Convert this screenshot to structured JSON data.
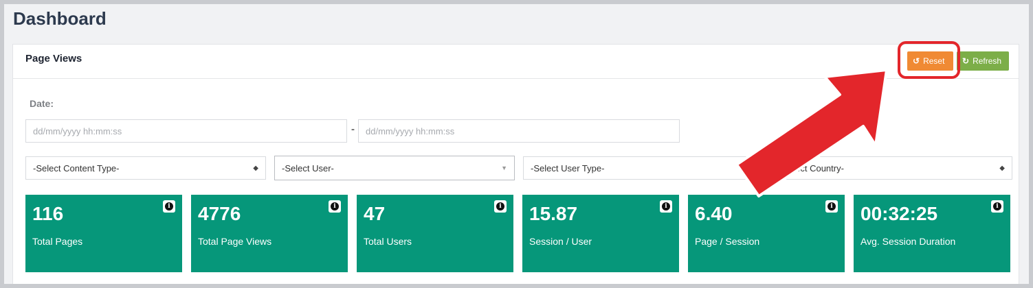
{
  "page": {
    "title": "Dashboard"
  },
  "card": {
    "title": "Page Views",
    "reset_label": "Reset",
    "refresh_label": "Refresh"
  },
  "filters": {
    "date_label": "Date:",
    "date_from_placeholder": "dd/mm/yyyy hh:mm:ss",
    "date_separator": "-",
    "date_to_placeholder": "dd/mm/yyyy hh:mm:ss",
    "content_type": "-Select Content Type-",
    "user": "-Select User-",
    "user_type": "-Select User Type-",
    "country": "-Select Country-"
  },
  "stats": [
    {
      "value": "116",
      "label": "Total Pages"
    },
    {
      "value": "4776",
      "label": "Total Page Views"
    },
    {
      "value": "47",
      "label": "Total Users"
    },
    {
      "value": "15.87",
      "label": "Session / User"
    },
    {
      "value": "6.40",
      "label": "Page / Session"
    },
    {
      "value": "00:32:25",
      "label": "Avg. Session Duration"
    }
  ],
  "colors": {
    "stat_bg": "#06977a",
    "reset_btn": "#f08a34",
    "refresh_btn": "#7cae48",
    "annotation": "#e3262b"
  },
  "icons": {
    "reset": "undo-icon",
    "refresh": "refresh-icon",
    "info": "info-icon",
    "select": "chevron-down-icon"
  }
}
